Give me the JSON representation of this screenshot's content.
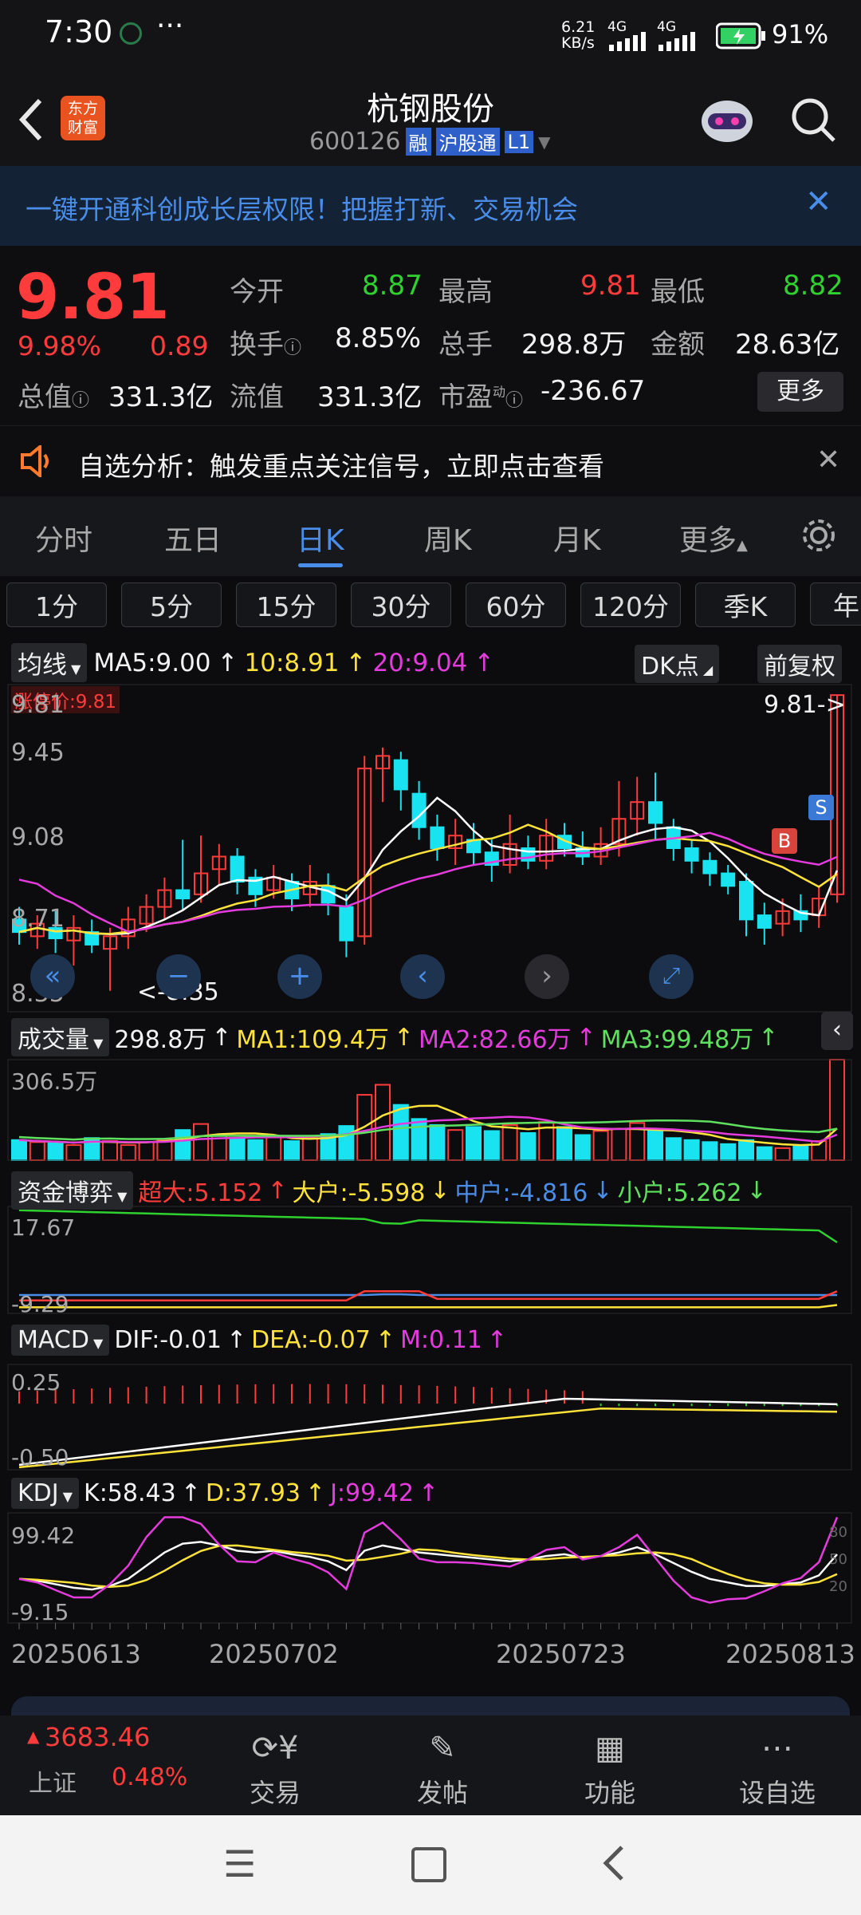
{
  "status_bar": {
    "time": "7:30",
    "net_speed": "6.21",
    "net_unit": "KB/s",
    "signal1": "4G",
    "signal2": "4G",
    "battery": "91%"
  },
  "header": {
    "logo": "东方\n财富",
    "title": "杭钢股份",
    "code": "600126",
    "tag1": "融",
    "tag2": "沪股通",
    "tag3": "L1"
  },
  "banner": {
    "text": "一键开通科创成长层权限！把握打新、交易机会"
  },
  "quote": {
    "price": "9.81",
    "change_pct": "9.98%",
    "change": "0.89",
    "open_label": "今开",
    "open": "8.87",
    "high_label": "最高",
    "high": "9.81",
    "low_label": "最低",
    "low": "8.82",
    "turnover_label": "换手",
    "turnover": "8.85%",
    "volume_label": "总手",
    "volume": "298.8万",
    "amount_label": "金额",
    "amount": "28.63亿",
    "total_cap_label": "总值",
    "total_cap": "331.3亿",
    "float_cap_label": "流值",
    "float_cap": "331.3亿",
    "pe_label": "市盈",
    "pe_sup": "动",
    "pe": "-236.67",
    "more": "更多"
  },
  "notice": {
    "text": "自选分析：触发重点关注信号，立即点击查看"
  },
  "tabs": [
    "分时",
    "五日",
    "日K",
    "周K",
    "月K",
    "更多"
  ],
  "active_tab": 2,
  "periods": [
    "1分",
    "5分",
    "15分",
    "30分",
    "60分",
    "120分",
    "季K",
    "年"
  ],
  "kline": {
    "indicator": "均线",
    "ma5": "MA5:9.00",
    "ma10": "10:8.91",
    "ma20": "20:9.04",
    "dk": "DK点",
    "adjust": "前复权",
    "price_flag": "涨停价:9.81",
    "y_labels": [
      "9.81",
      "9.45",
      "9.08",
      "8.71",
      "8.35"
    ],
    "last_label": "9.81->",
    "low_label": "<-8.35",
    "marker_b": "B",
    "marker_s": "S"
  },
  "volume": {
    "label": "成交量",
    "value": "298.8万",
    "ma1": "MA1:109.4万",
    "ma2": "MA2:82.66万",
    "ma3": "MA3:99.48万",
    "ymax": "306.5万"
  },
  "capital": {
    "label": "资金博弈",
    "super": "超大:5.152",
    "large": "大户:-5.598",
    "medium": "中户:-4.816",
    "small": "小户:5.262",
    "ymax": "17.67",
    "ymin": "-9.29"
  },
  "macd": {
    "label": "MACD",
    "dif": "DIF:-0.01",
    "dea": "DEA:-0.07",
    "m": "M:0.11",
    "ymax": "0.25",
    "ymin": "-0.50"
  },
  "kdj": {
    "label": "KDJ",
    "k": "K:58.43",
    "d": "D:37.93",
    "j": "J:99.42",
    "ymax": "99.42",
    "ymin": "-9.15",
    "r1": "80",
    "r2": "50",
    "r3": "20"
  },
  "dates": [
    "20250613",
    "20250702",
    "20250723",
    "20250813"
  ],
  "bottom_nav": {
    "index_value": "3683.46",
    "index_name": "上证",
    "index_pct": "0.48%",
    "items": [
      "交易",
      "发帖",
      "功能",
      "设自选"
    ]
  },
  "colors": {
    "up": "#ff3b3b",
    "down": "#19e3f0",
    "ma5": "#ffffff",
    "ma10": "#ffe33a",
    "ma20": "#e33bdc",
    "accent": "#4a8de8"
  }
}
